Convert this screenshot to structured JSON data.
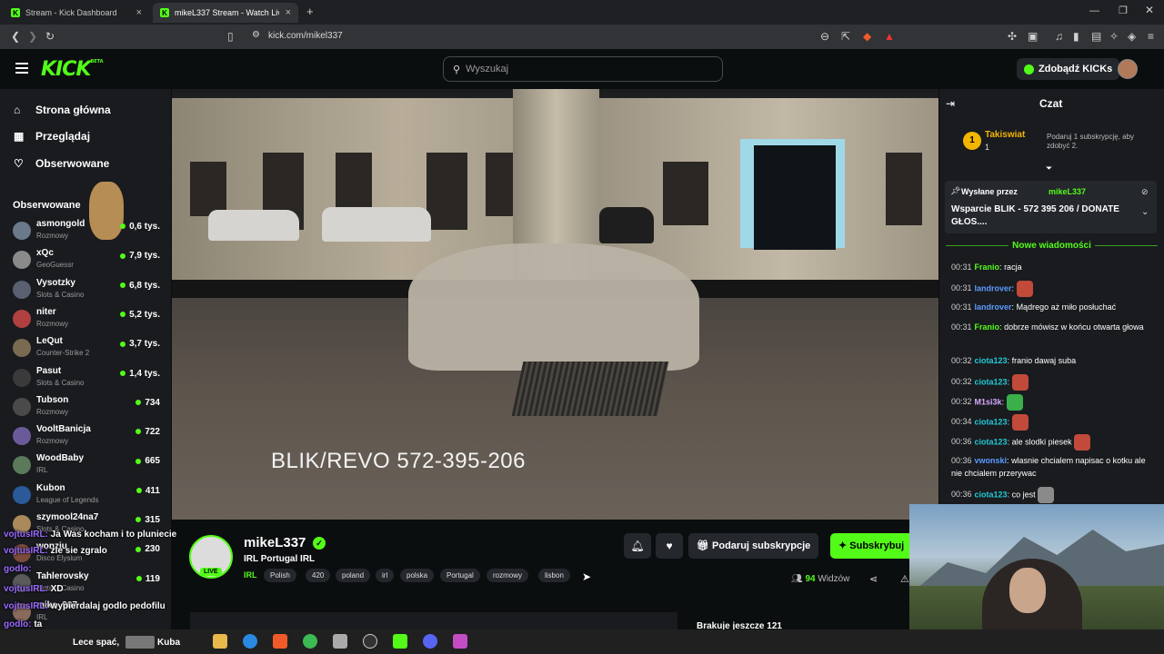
{
  "browser": {
    "tabs": [
      {
        "title": "Stream - Kick Dashboard"
      },
      {
        "title": "mikeL337 Stream - Watch Liv"
      }
    ],
    "new_tab": "+",
    "url": "kick.com/mikel337",
    "window_controls": [
      "minimize-icon",
      "restore-icon",
      "close-icon"
    ]
  },
  "header": {
    "logo": "KICK",
    "logo_badge": "BETA",
    "search_placeholder": "Wyszukaj",
    "kicks_button": "Zdobądź KICKs"
  },
  "sidebar": {
    "nav": [
      {
        "label": "Strona główna",
        "icon": "home-icon"
      },
      {
        "label": "Przeglądaj",
        "icon": "browse-icon"
      },
      {
        "label": "Obserwowane",
        "icon": "heart-icon"
      }
    ],
    "followed_title": "Obserwowane",
    "channels": [
      {
        "name": "asmongold",
        "category": "Rozmowy",
        "viewers": "0,6 tys."
      },
      {
        "name": "xQc",
        "category": "GeoGuessr",
        "viewers": "7,9 tys."
      },
      {
        "name": "Vysotzky",
        "category": "Slots & Casino",
        "viewers": "6,8 tys."
      },
      {
        "name": "niter",
        "category": "Rozmowy",
        "viewers": "5,2 tys."
      },
      {
        "name": "LeQut",
        "category": "Counter-Strike 2",
        "viewers": "3,7 tys."
      },
      {
        "name": "Pasut",
        "category": "Slots & Casino",
        "viewers": "1,4 tys."
      },
      {
        "name": "Tubson",
        "category": "Rozmowy",
        "viewers": "734"
      },
      {
        "name": "VooltBanicja",
        "category": "Rozmowy",
        "viewers": "722"
      },
      {
        "name": "WoodBaby",
        "category": "IRL",
        "viewers": "665"
      },
      {
        "name": "Kubon",
        "category": "League of Legends",
        "viewers": "411"
      },
      {
        "name": "szymool24na7",
        "category": "Slots & Casino",
        "viewers": "315"
      },
      {
        "name": "wonziu",
        "category": "Disco Elysium",
        "viewers": "230"
      },
      {
        "name": "Tahlerovsky",
        "category": "Slots & Casino",
        "viewers": "119"
      },
      {
        "name": "mike_907",
        "category": "IRL",
        "viewers": ""
      }
    ]
  },
  "video": {
    "overlay_text": "BLIK/REVO  572-395-206"
  },
  "stream": {
    "streamer": "mikeL337",
    "live": "LIVE",
    "title": "IRL Portugal IRL",
    "category": "IRL",
    "tags": [
      "Polish",
      "420",
      "poland",
      "irl",
      "polska",
      "Portugal",
      "rozmowy",
      "lisbon"
    ],
    "gift_button": "Podaruj subskrypcje",
    "subscribe_button": "Subskrybuj",
    "viewers_count": "94",
    "viewers_label": "Widzów",
    "goal_text": "Brakuje jeszcze 121"
  },
  "chat": {
    "title": "Czat",
    "top_gifter": {
      "rank": "1",
      "name": "Takiswiat",
      "count": "1",
      "hint": "Podaruj 1 subskrypcję, aby zdobyć 2."
    },
    "pinned": {
      "by_label": "Wysłane przez",
      "user": "mikeL337",
      "message": "Wsparcie BLIK - 572 395 206 / DONATE GŁOS...."
    },
    "new_messages": "Nowe wiadomości",
    "messages": [
      {
        "time": "00:31",
        "user": "Franio",
        "text": "racja",
        "color": "#53fc18"
      },
      {
        "time": "00:31",
        "user": "landrover",
        "text": "",
        "color": "#5c9bff"
      },
      {
        "time": "00:31",
        "user": "landrover",
        "text": "Mądrego aż miło posłuchać",
        "color": "#5c9bff"
      },
      {
        "time": "00:31",
        "user": "Franio",
        "text": "dobrze mówisz w końcu otwarta głowa",
        "color": "#53fc18"
      },
      {
        "time": "00:32",
        "user": "ciota123",
        "text": "franio dawaj suba",
        "color": "#22c9d6"
      },
      {
        "time": "00:32",
        "user": "ciota123",
        "text": "",
        "color": "#22c9d6"
      },
      {
        "time": "00:32",
        "user": "M1si3k",
        "text": "",
        "color": "#d7a8ff"
      },
      {
        "time": "00:34",
        "user": "ciota123",
        "text": "",
        "color": "#22c9d6"
      },
      {
        "time": "00:36",
        "user": "ciota123",
        "text": "ale slodki piesek",
        "color": "#22c9d6"
      },
      {
        "time": "00:36",
        "user": "vwonski",
        "text": "wlasnie chcialem napisac o kotku ale nie chcialem przerywac",
        "color": "#5c9bff"
      },
      {
        "time": "00:36",
        "user": "ciota123",
        "text": "co jest",
        "color": "#22c9d6"
      }
    ]
  },
  "overlay_chat": [
    {
      "user": "vojtusIRL:",
      "text": "Ja Was kocham i to pluniecie"
    },
    {
      "user": "vojtusIRL:",
      "text": "zle sie zgralo"
    },
    {
      "user": "godlo:",
      "text": ""
    },
    {
      "user": "vojtusIRL:",
      "text": "XD"
    },
    {
      "user": "vojtusIRL:",
      "text": "wypierdalaj godlo pedofilu"
    },
    {
      "user": "godlo:",
      "text": "ta"
    }
  ],
  "taskbar": {
    "items": [
      "Lece spać,",
      "Kuba"
    ]
  }
}
